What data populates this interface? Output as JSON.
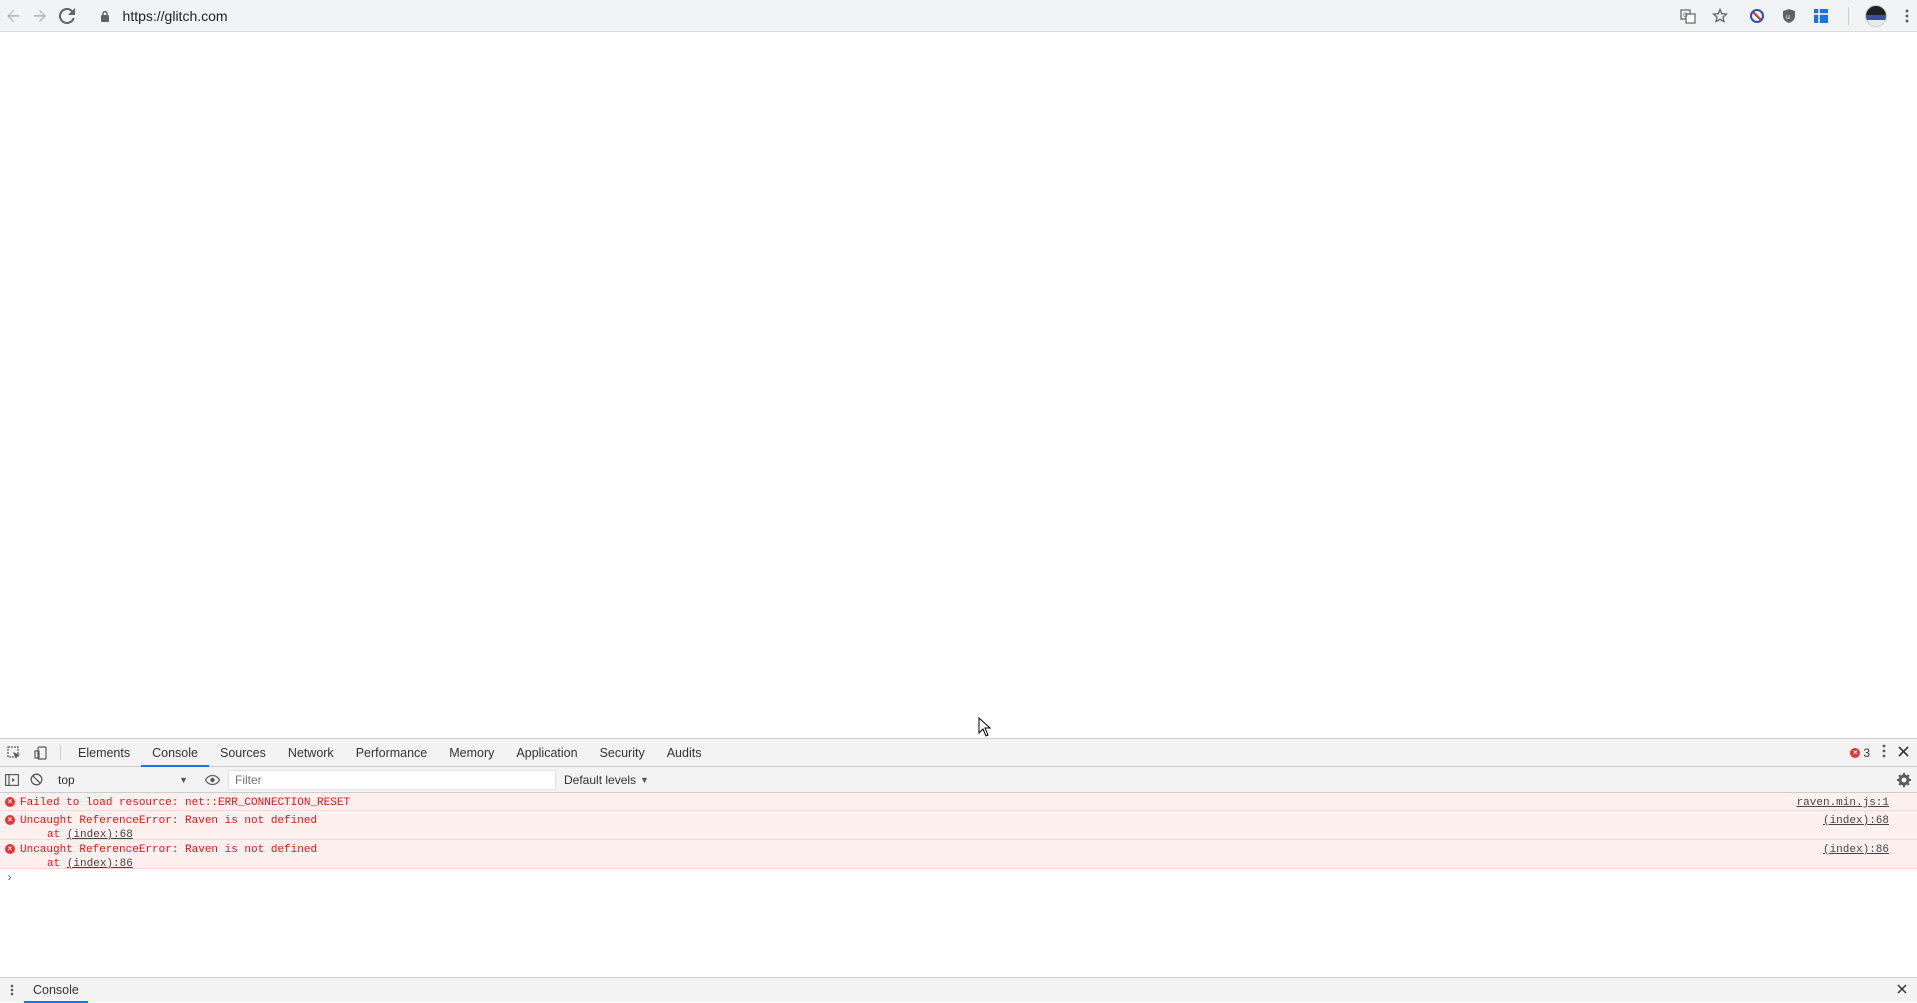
{
  "browser": {
    "url": "https://glitch.com"
  },
  "devtools": {
    "tabs": [
      {
        "label": "Elements"
      },
      {
        "label": "Console"
      },
      {
        "label": "Sources"
      },
      {
        "label": "Network"
      },
      {
        "label": "Performance"
      },
      {
        "label": "Memory"
      },
      {
        "label": "Application"
      },
      {
        "label": "Security"
      },
      {
        "label": "Audits"
      }
    ],
    "active_tab": "Console",
    "error_count": "3",
    "context": "top",
    "filter_placeholder": "Filter",
    "levels": "Default levels",
    "messages": [
      {
        "text": "Failed to load resource: net::ERR_CONNECTION_RESET",
        "source": "raven.min.js:1",
        "stack_prefix": "",
        "stack_link": ""
      },
      {
        "text": "Uncaught ReferenceError: Raven is not defined",
        "source": "(index):68",
        "stack_prefix": "at ",
        "stack_link": "(index):68"
      },
      {
        "text": "Uncaught ReferenceError: Raven is not defined",
        "source": "(index):86",
        "stack_prefix": "at ",
        "stack_link": "(index):86"
      }
    ],
    "prompt": "›",
    "drawer_tab": "Console"
  },
  "colors": {
    "accent": "#1a73e8",
    "error": "#e11111",
    "error_bg": "#fff0f0"
  }
}
